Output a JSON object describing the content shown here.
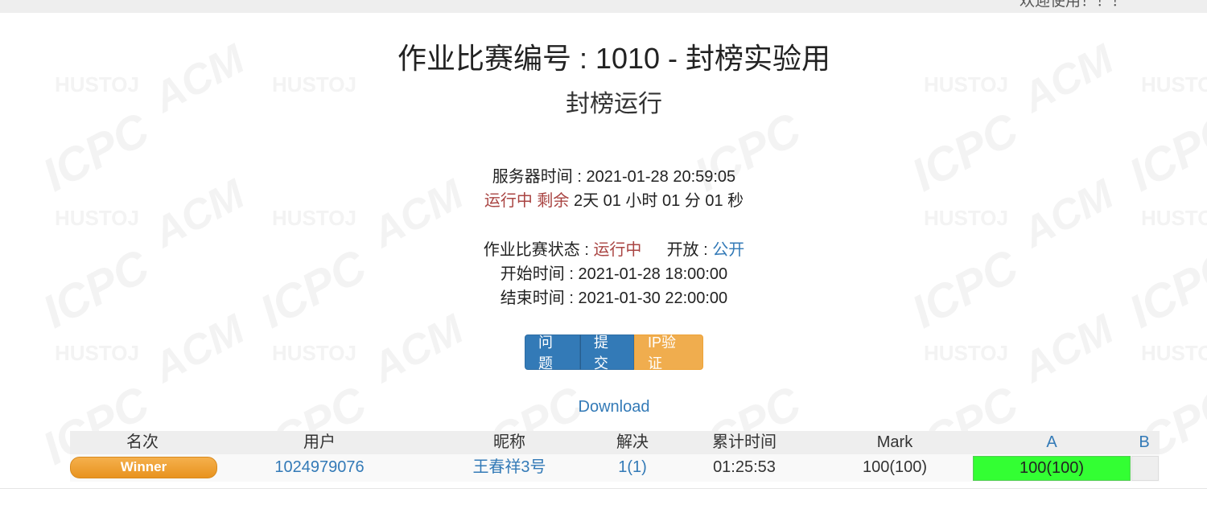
{
  "header": {
    "welcome": "欢迎使用！！！"
  },
  "watermark": {
    "hustoj": "HUSTOJ",
    "acm": "ACM",
    "icpc": "ICPC"
  },
  "contest": {
    "title": "作业比赛编号 : 1010 - 封榜实验用",
    "subtitle": "封榜运行",
    "server_time_label": "服务器时间 : ",
    "server_time": "2021-01-28 20:59:05",
    "running_label": "运行中 剩余",
    "remaining": " 2天 01 小时 01 分 01 秒",
    "status_label": "作业比赛状态 : ",
    "status_value": "运行中",
    "open_label": "开放 : ",
    "open_value": "公开",
    "start_label": "开始时间 : ",
    "start_time": "2021-01-28 18:00:00",
    "end_label": "结束时间 : ",
    "end_time": "2021-01-30 22:00:00"
  },
  "buttons": {
    "problems": "问题",
    "submit": "提交",
    "ip_verify": "IP验证"
  },
  "download": "Download",
  "ranklist": {
    "headers": {
      "rank": "名次",
      "user": "用户",
      "nick": "昵称",
      "solved": "解决",
      "time": "累计时间",
      "mark": "Mark",
      "problem_a": "A",
      "problem_b": "B"
    },
    "rows": [
      {
        "rank": "Winner",
        "user": "1024979076",
        "nick": "王春祥3号",
        "solved": "1(1)",
        "time": "01:25:53",
        "mark": "100(100)",
        "a": "100(100)",
        "b": ""
      }
    ]
  },
  "colors": {
    "accepted": "#33ff33",
    "winner": "#f0ad4e",
    "primary": "#337ab7",
    "status_red": "#a94442"
  }
}
